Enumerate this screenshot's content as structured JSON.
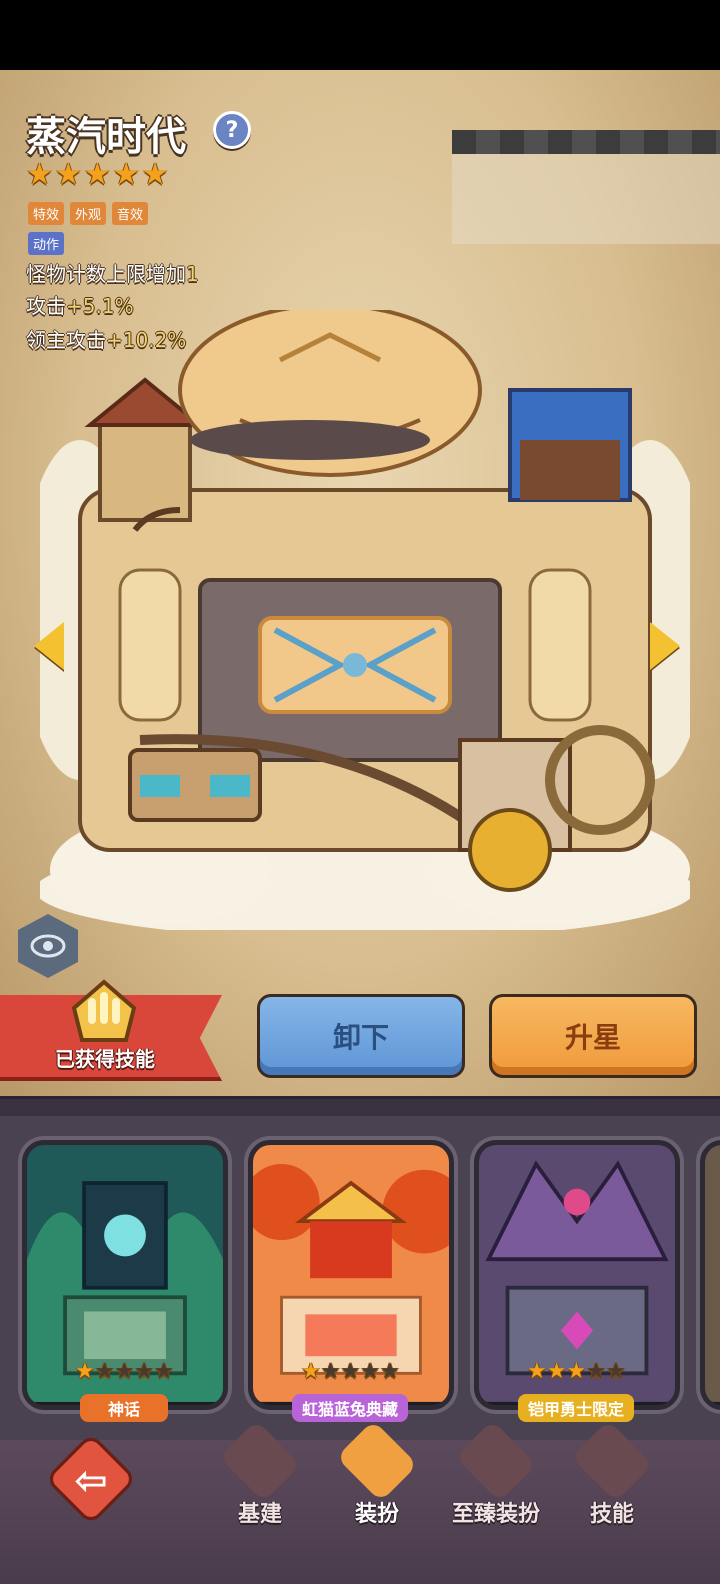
{
  "skin": {
    "title": "蒸汽时代",
    "stars": 5,
    "tags": [
      "特效",
      "外观",
      "音效"
    ],
    "tags2": [
      "动作"
    ],
    "stats": [
      {
        "label": "怪物计数上限增加",
        "value": "1"
      },
      {
        "label": "攻击",
        "value": "+5.1%"
      },
      {
        "label": "领主攻击",
        "value": "+10.2%"
      }
    ]
  },
  "actions": {
    "skill_label": "已获得技能",
    "unload_label": "卸下",
    "upgrade_label": "升星"
  },
  "cards": [
    {
      "stars": 1,
      "badge": "神话",
      "badge_color": "#e8722a",
      "theme": "teal"
    },
    {
      "stars": 1,
      "badge": "虹猫蓝兔典藏",
      "badge_color": "#b864d8",
      "theme": "orange"
    },
    {
      "stars": 3,
      "badge": "铠甲勇士限定",
      "badge_color": "#e6b020",
      "theme": "purple"
    }
  ],
  "nav": {
    "items": [
      {
        "label": "基建",
        "icon": "pillar-icon",
        "active": false
      },
      {
        "label": "装扮",
        "icon": "costume-icon",
        "active": true
      },
      {
        "label": "至臻装扮",
        "icon": "premium-costume-icon",
        "active": false
      },
      {
        "label": "技能",
        "icon": "skill-icon",
        "active": false
      }
    ]
  },
  "colors": {
    "accent": "#f09a3a",
    "star": "#f4a21c",
    "unload": "#5e95d6",
    "banner": "#d9473b"
  }
}
